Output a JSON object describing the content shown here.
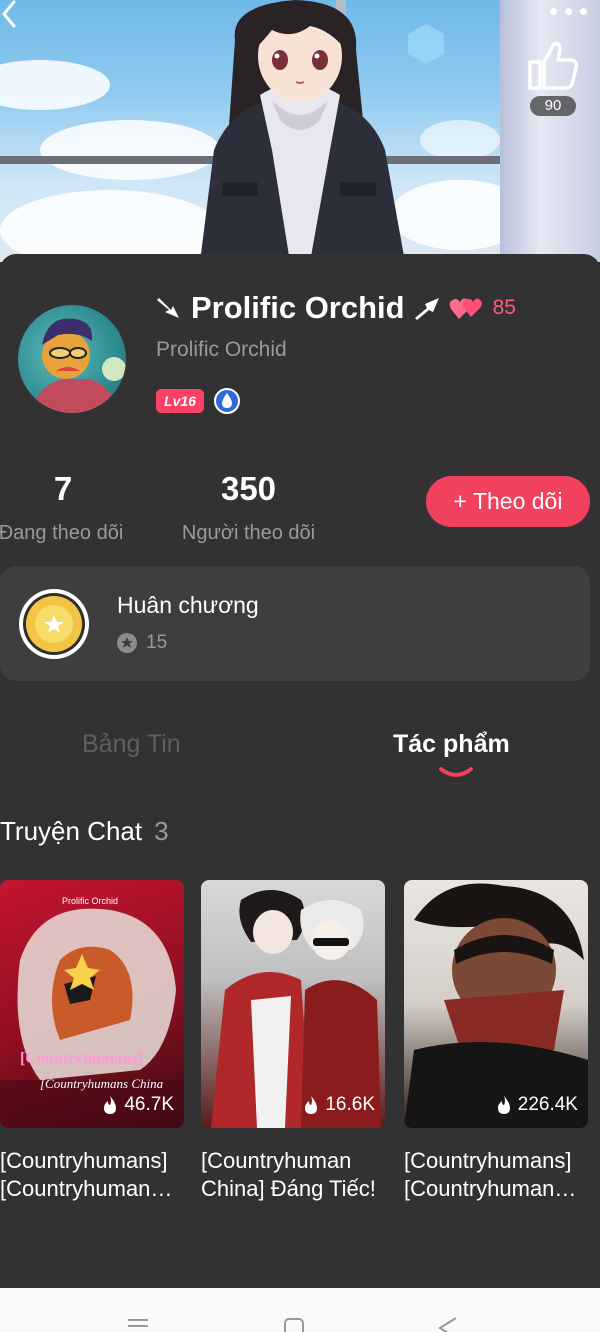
{
  "banner": {
    "like_count": "90"
  },
  "profile": {
    "name": "Prolific Orchid",
    "reputation": "85",
    "handle": "Prolific Orchid",
    "level": "Lv16"
  },
  "stats": {
    "following_count": "7",
    "following_label": "Đang theo dõi",
    "followers_count": "350",
    "followers_label": "Người theo dõi"
  },
  "follow_button": {
    "label": "+ Theo dõi"
  },
  "medals": {
    "title": "Huân chương",
    "count": "15"
  },
  "tabs": [
    {
      "label": "Bảng Tin",
      "active": false
    },
    {
      "label": "Tác phẩm",
      "active": true
    }
  ],
  "section": {
    "title": "Truyện Chat",
    "count": "3"
  },
  "stories": [
    {
      "title": "[Countryhumans] [Countryhuman…",
      "views": "46.7K",
      "cover_author": "Prolific Orchid",
      "cover_title": "[Countryhumans]",
      "cover_subtitle": "[Countryhumans China"
    },
    {
      "title": "[Countryhuman China] Đáng Tiếc!",
      "views": "16.6K"
    },
    {
      "title": "[Countryhumans] [Countryhuman…",
      "views": "226.4K"
    }
  ],
  "colors": {
    "accent": "#f2415e",
    "background": "#323232",
    "card": "#3e3e3e"
  }
}
